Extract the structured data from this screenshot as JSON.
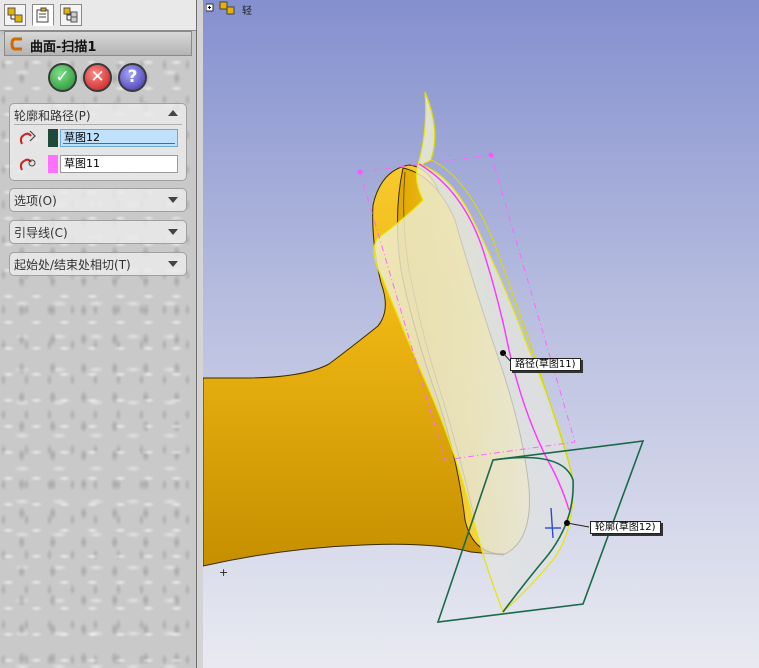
{
  "tabs": [
    {
      "name": "featuremanager",
      "icon": "feature-tree-icon"
    },
    {
      "name": "propertymanager",
      "icon": "property-manager-icon"
    },
    {
      "name": "configurationmanager",
      "icon": "configuration-icon"
    }
  ],
  "feature": {
    "title": "曲面-扫描1",
    "icon": "sweep-surface-icon"
  },
  "actions": {
    "ok": "✓",
    "cancel": "✕",
    "help": "?"
  },
  "groups": {
    "profile_path": {
      "label": "轮廓和路径(P)",
      "expanded": true,
      "profile": {
        "value": "草图12",
        "color": "#1f4a3a",
        "icon": "profile-icon"
      },
      "path": {
        "value": "草图11",
        "color": "#ff70ff",
        "icon": "path-icon"
      }
    },
    "options": {
      "label": "选项(O)",
      "expanded": false
    },
    "guides": {
      "label": "引导线(C)",
      "expanded": false
    },
    "tangency": {
      "label": "起始处/结束处相切(T)",
      "expanded": false
    }
  },
  "viewport": {
    "tree_label": "轻",
    "callouts": {
      "path": "路径(草图11)",
      "profile": "轮廓(草图12)"
    },
    "colors": {
      "body": "#f2c431",
      "profile_sketch": "#1a6a4a",
      "path_sketch": "#ff66ff",
      "sweep_edge": "#e6e600"
    }
  }
}
